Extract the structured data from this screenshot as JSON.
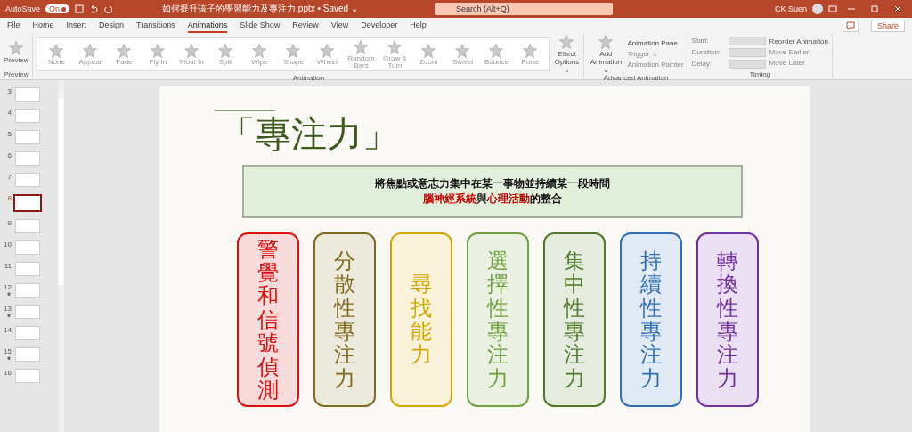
{
  "title_bar": {
    "autosave_label": "AutoSave",
    "autosave_toggle": {
      "label": "On",
      "on": true
    },
    "file_title": "如何提升孩子的學習能力及專注力.pptx • Saved ⌄",
    "search": {
      "placeholder": "Search (Alt+Q)"
    },
    "user_name": "CK Suen"
  },
  "tabs": [
    {
      "label": "File",
      "selected": false
    },
    {
      "label": "Home",
      "selected": false
    },
    {
      "label": "Insert",
      "selected": false
    },
    {
      "label": "Design",
      "selected": false
    },
    {
      "label": "Transitions",
      "selected": false
    },
    {
      "label": "Animations",
      "selected": true
    },
    {
      "label": "Slide Show",
      "selected": false
    },
    {
      "label": "Review",
      "selected": false
    },
    {
      "label": "View",
      "selected": false
    },
    {
      "label": "Developer",
      "selected": false
    },
    {
      "label": "Help",
      "selected": false
    }
  ],
  "share_button": "Share",
  "ribbon": {
    "preview_button": "Preview",
    "preview_group": "Preview",
    "effects": [
      "None",
      "Appear",
      "Fade",
      "Fly In",
      "Float In",
      "Split",
      "Wipe",
      "Shape",
      "Wheel",
      "Random Bars",
      "Grow & Turn",
      "Zoom",
      "Swivel",
      "Bounce",
      "Pulse"
    ],
    "effect_options": "Effect Options ⌄",
    "animation_group": "Animation",
    "add_animation": "Add Animation ⌄",
    "animation_pane": "Animation Pane",
    "trigger": "Trigger ⌄",
    "animation_painter": "Animation Painter",
    "advanced_group": "Advanced Animation",
    "start_label": "Start:",
    "duration_label": "Duration:",
    "delay_label": "Delay:",
    "reorder_title": "Reorder Animation",
    "move_earlier": "Move Earlier",
    "move_later": "Move Later",
    "timing_group": "Timing"
  },
  "slides": [
    {
      "number": "3",
      "selected": false,
      "animated": false
    },
    {
      "number": "4",
      "selected": false,
      "animated": false
    },
    {
      "number": "5",
      "selected": false,
      "animated": false
    },
    {
      "number": "6",
      "selected": false,
      "animated": false
    },
    {
      "number": "7",
      "selected": false,
      "animated": false
    },
    {
      "number": "8",
      "selected": true,
      "animated": false
    },
    {
      "number": "9",
      "selected": false,
      "animated": false
    },
    {
      "number": "10",
      "selected": false,
      "animated": false
    },
    {
      "number": "11",
      "selected": false,
      "animated": false
    },
    {
      "number": "12",
      "selected": false,
      "animated": true
    },
    {
      "number": "13",
      "selected": false,
      "animated": true
    },
    {
      "number": "14",
      "selected": false,
      "animated": false
    },
    {
      "number": "15",
      "selected": false,
      "animated": true
    },
    {
      "number": "16",
      "selected": false,
      "animated": false
    }
  ],
  "slide": {
    "title": "「專注力」",
    "definition_lines": [
      [
        {
          "text": "將焦點或意志力集中在某一事物並持續某一段時間",
          "emphasis": false
        }
      ],
      [
        {
          "text": "腦神經系統",
          "emphasis": true
        },
        {
          "text": "與",
          "emphasis": false
        },
        {
          "text": "心理活動",
          "emphasis": true
        },
        {
          "text": "的整合",
          "emphasis": false
        }
      ]
    ],
    "cards": [
      {
        "text": "警覺和信號偵測",
        "color": "#e01010"
      },
      {
        "text": "分散性專注力",
        "color": "#7f6a1e"
      },
      {
        "text": "尋找能力",
        "color": "#d4a800"
      },
      {
        "text": "選擇性專注力",
        "color": "#70a040"
      },
      {
        "text": "集中性專注力",
        "color": "#4f7a2a"
      },
      {
        "text": "持續性專注力",
        "color": "#2f6fb5"
      },
      {
        "text": "轉換性專注力",
        "color": "#7030a0"
      }
    ]
  }
}
